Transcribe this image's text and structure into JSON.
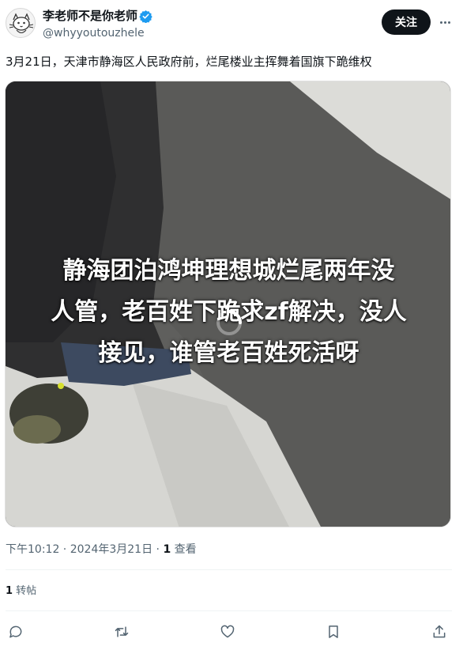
{
  "author": {
    "display_name": "李老师不是你老师",
    "handle": "@whyyoutouzhele",
    "verified": true,
    "avatar_icon": "cat-sketch-avatar"
  },
  "header": {
    "follow_label": "关注",
    "more_icon": "more-horizontal-icon"
  },
  "tweet": {
    "text": "3月21日，天津市静海区人民政府前，烂尾楼业主挥舞着国旗下跪维权",
    "media": {
      "type": "video",
      "caption_lines": [
        "静海团泊鸿坤理想城烂尾两年没",
        "人管，老百姓下跪求zf解决，没人",
        "接见，谁管老百姓死活呀"
      ]
    }
  },
  "meta": {
    "time": "下午10:12",
    "separator1": " · ",
    "date": "2024年3月21日",
    "separator2": " · ",
    "views_count": "1",
    "views_label": " 查看"
  },
  "stats": {
    "retweets_count": "1",
    "retweets_label": " 转帖"
  },
  "actions": {
    "reply_icon": "reply-icon",
    "retweet_icon": "retweet-icon",
    "like_icon": "like-icon",
    "bookmark_icon": "bookmark-icon",
    "share_icon": "share-icon"
  },
  "colors": {
    "text_primary": "#0f1419",
    "text_secondary": "#536471",
    "verified_blue": "#1d9bf0",
    "divider": "#eff3f4"
  }
}
